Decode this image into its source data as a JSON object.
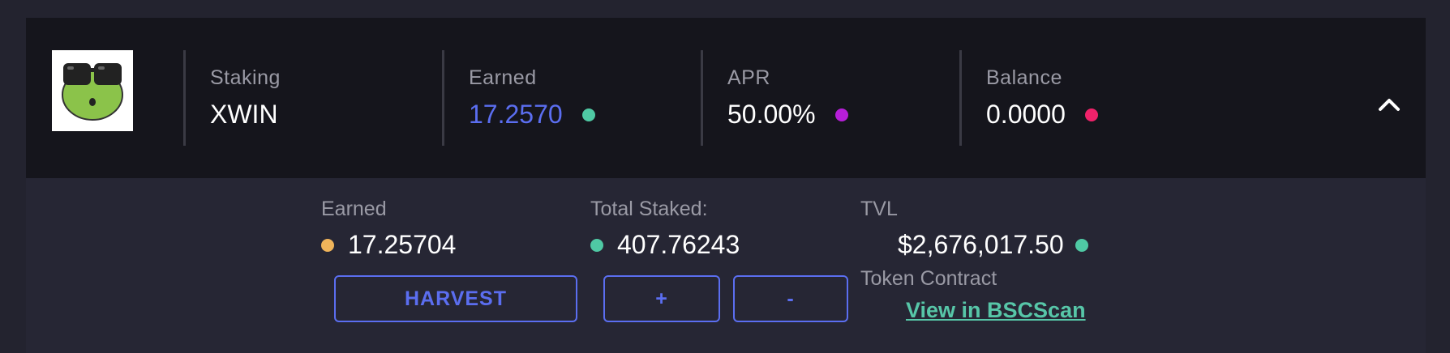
{
  "pool": {
    "stats": [
      {
        "label": "Staking",
        "value": "XWIN"
      },
      {
        "label": "Earned",
        "value": "17.2570",
        "dot_color": "#4fc9a4",
        "value_color": "#5b6ef0"
      },
      {
        "label": "APR",
        "value": "50.00%",
        "dot_color": "#b61ed8"
      },
      {
        "label": "Balance",
        "value": "0.0000",
        "dot_color": "#f0226a"
      }
    ],
    "toggle_icon": "chevron-up-icon"
  },
  "details": {
    "earned": {
      "label": "Earned",
      "value": "17.25704",
      "dot_color": "#f0b45a"
    },
    "total_staked": {
      "label": "Total Staked:",
      "value": "407.76243",
      "dot_color": "#4fc9a4"
    },
    "tvl": {
      "label": "TVL",
      "value": "$2,676,017.50",
      "dot_color": "#4fc9a4"
    },
    "token_contract": {
      "label": "Token Contract",
      "link_text": "View in BSCScan"
    },
    "buttons": {
      "harvest": "HARVEST",
      "stake": "+",
      "unstake": "-"
    }
  },
  "colors": {
    "accent": "#5b6ef0",
    "link": "#57c6a8"
  }
}
